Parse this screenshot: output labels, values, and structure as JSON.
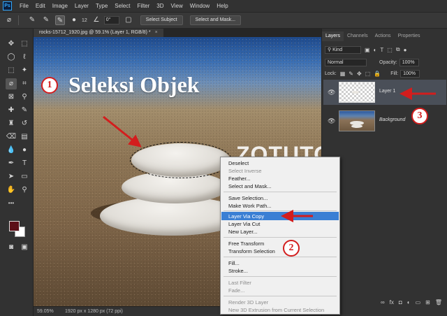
{
  "menubar": {
    "logo": "Ps",
    "items": [
      "File",
      "Edit",
      "Image",
      "Layer",
      "Type",
      "Select",
      "Filter",
      "3D",
      "View",
      "Window",
      "Help"
    ]
  },
  "options": {
    "brush_size": "12",
    "angle": "0°",
    "select_subject": "Select Subject",
    "select_and_mask": "Select and Mask..."
  },
  "document": {
    "tab_title": "rocks-15712_1920.jpg @ 59.1% (Layer 1, RGB/8) *",
    "close_glyph": "×",
    "zoom": "59.05%",
    "dimensions": "1920 px x 1280 px (72 ppi)"
  },
  "overlay": {
    "title": "Seleksi Objek",
    "watermark": "ZOTUTORIAL.COM",
    "badge_1": "1",
    "badge_2": "2",
    "badge_3": "3"
  },
  "context_menu": {
    "items": [
      {
        "label": "Deselect",
        "disabled": false
      },
      {
        "label": "Select Inverse",
        "disabled": true
      },
      {
        "label": "Feather...",
        "disabled": false
      },
      {
        "label": "Select and Mask...",
        "disabled": false
      },
      {
        "label": "Save Selection...",
        "disabled": false
      },
      {
        "label": "Make Work Path...",
        "disabled": false
      },
      {
        "label": "Layer Via Copy",
        "disabled": false,
        "highlighted": true
      },
      {
        "label": "Layer Via Cut",
        "disabled": false
      },
      {
        "label": "New Layer...",
        "disabled": false
      },
      {
        "label": "Free Transform",
        "disabled": false
      },
      {
        "label": "Transform Selection",
        "disabled": false
      },
      {
        "label": "Fill...",
        "disabled": false
      },
      {
        "label": "Stroke...",
        "disabled": false
      },
      {
        "label": "Last Filter",
        "disabled": true
      },
      {
        "label": "Fade...",
        "disabled": true
      },
      {
        "label": "Render 3D Layer",
        "disabled": true
      },
      {
        "label": "New 3D Extrusion from Current Selection",
        "disabled": true
      }
    ]
  },
  "panels": {
    "tabs": [
      "Layers",
      "Channels",
      "Actions",
      "Properties"
    ],
    "active_tab": "Layers",
    "filter_kind": "Kind",
    "blend_mode": "Normal",
    "opacity_label": "Opacity:",
    "opacity_value": "100%",
    "lock_label": "Lock:",
    "fill_label": "Fill:",
    "fill_value": "100%",
    "layers": [
      {
        "name": "Layer 1",
        "selected": true
      },
      {
        "name": "Background",
        "selected": false
      }
    ]
  },
  "colors": {
    "foreground": "#5c1018",
    "background": "#ffffff",
    "annotation_red": "#d31d1d",
    "menu_highlight": "#3a7fd4"
  }
}
